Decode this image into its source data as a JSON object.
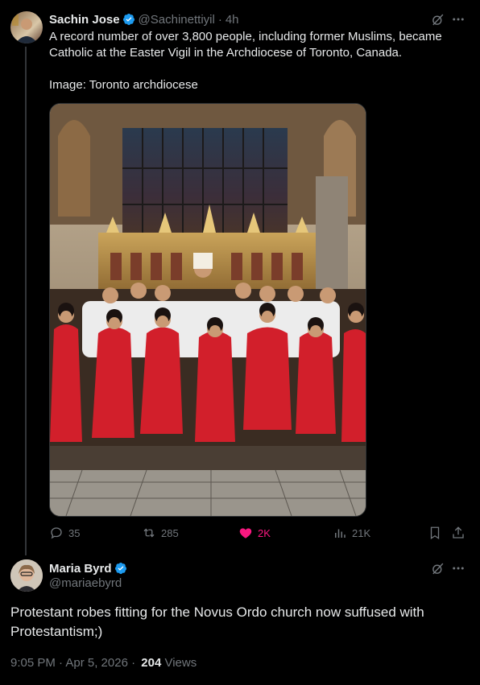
{
  "tweet1": {
    "author_name": "Sachin Jose",
    "handle": "@Sachinettiyil",
    "separator": "·",
    "time": "4h",
    "text_line1": "A record number of over 3,800 people, including former Muslims, became",
    "text_line2": "Catholic at the Easter Vigil in the Archdiocese of Toronto, Canada.",
    "text_line3": "Image: Toronto archdiocese",
    "replies": "35",
    "reposts": "285",
    "likes": "2K",
    "views": "21K",
    "like_color": "#f91880"
  },
  "tweet2": {
    "author_name": "Maria Byrd",
    "handle": "@mariaebyrd",
    "text_line1": "Protestant robes fitting for the Novus Ordo church now suffused with",
    "text_line2": "Protestantism;)",
    "timestamp": "9:05 PM · Apr 5, 2026 ·",
    "views_count": "204",
    "views_label": "Views"
  },
  "colors": {
    "verified": "#1d9bf0",
    "robe_red": "#d21f2b",
    "background": "#000000"
  },
  "icons": [
    "grok-icon",
    "more-icon",
    "reply-icon",
    "repost-icon",
    "like-icon",
    "views-icon",
    "bookmark-icon",
    "share-icon",
    "verified-badge-icon"
  ]
}
